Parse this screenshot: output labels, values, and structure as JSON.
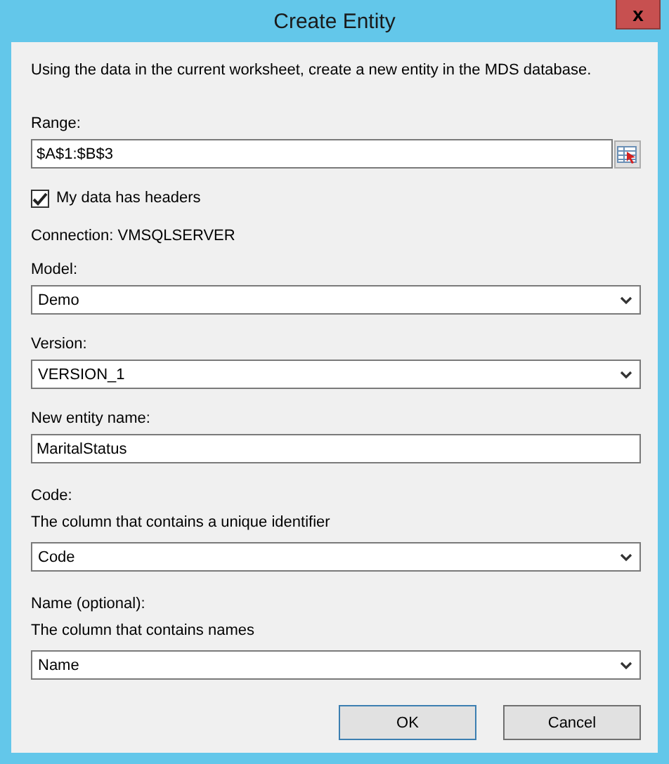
{
  "window": {
    "title": "Create Entity",
    "close": "x"
  },
  "description": "Using the data in the current worksheet, create a new entity in the MDS database.",
  "range": {
    "label": "Range:",
    "value": "$A$1:$B$3"
  },
  "headers": {
    "label": "My data has headers",
    "checked": true
  },
  "connection": "Connection: VMSQLSERVER",
  "fields": [
    {
      "kind": "dropdown",
      "label": "Model:",
      "value": "Demo"
    },
    {
      "kind": "dropdown",
      "label": "Version:",
      "value": "VERSION_1"
    },
    {
      "kind": "text",
      "label": "New entity name:",
      "value": "MaritalStatus"
    },
    {
      "kind": "dropdown",
      "label": "Code:",
      "hint": "The column that contains a unique identifier",
      "value": "Code"
    },
    {
      "kind": "dropdown",
      "label": "Name (optional):",
      "hint": "The column that contains names",
      "value": "Name"
    }
  ],
  "buttons": [
    {
      "label": "OK",
      "default": true
    },
    {
      "label": "Cancel",
      "default": false
    }
  ]
}
